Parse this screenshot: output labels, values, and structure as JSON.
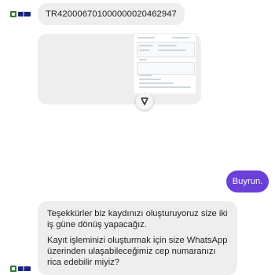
{
  "chat": {
    "messages": [
      {
        "sender": "bot",
        "text": "TR420006701000000020462947"
      },
      {
        "sender": "bot",
        "type": "document-thumbnail"
      },
      {
        "sender": "user",
        "text": "Buyrun."
      },
      {
        "sender": "bot",
        "paragraph_1": "Teşekkürler biz kaydınızı oluşturuyoruz size iki iş güne dönüş yapacağız.",
        "paragraph_2": "Kayıt işleminizi oluşturmak için size WhatsApp üzerinden ulaşabileceğimiz cep numaranızı rica edebilir miyiz?"
      }
    ]
  },
  "icons": {
    "bot_avatar": "company-logo-icon",
    "scroll_down": "chevron-down-icon"
  },
  "colors": {
    "user_bubble": "#6a40d9",
    "bot_bubble": "#eeeeee",
    "avatar_green": "#2e7d32",
    "avatar_navy": "#1a237e"
  }
}
